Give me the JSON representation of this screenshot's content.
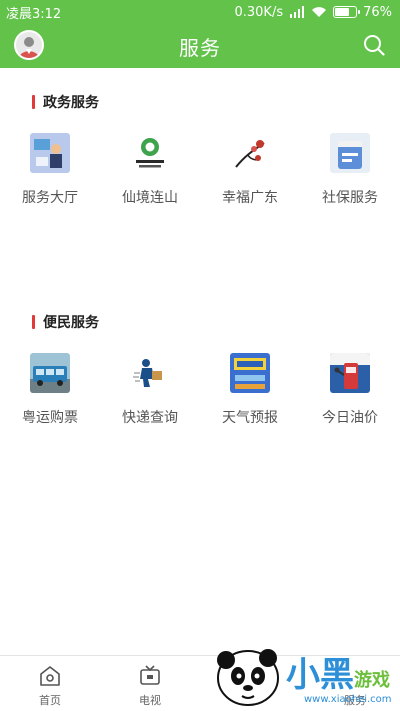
{
  "status_bar": {
    "time": "凌晨3:12",
    "speed": "0.30K/s",
    "battery": "76%",
    "battery_level": 0.76
  },
  "header": {
    "title": "服务",
    "avatar_icon": "user-avatar-icon",
    "search_icon": "search-icon"
  },
  "sections": [
    {
      "title": "政务服务",
      "items": [
        {
          "label": "服务大厅",
          "icon": "service-hall-icon"
        },
        {
          "label": "仙境连山",
          "icon": "lianshan-logo-icon"
        },
        {
          "label": "幸福广东",
          "icon": "happy-guangdong-icon"
        },
        {
          "label": "社保服务",
          "icon": "social-security-icon"
        }
      ]
    },
    {
      "title": "便民服务",
      "items": [
        {
          "label": "粤运购票",
          "icon": "bus-ticket-icon"
        },
        {
          "label": "快递查询",
          "icon": "courier-icon"
        },
        {
          "label": "天气预报",
          "icon": "weather-icon"
        },
        {
          "label": "今日油价",
          "icon": "fuel-price-icon"
        }
      ]
    }
  ],
  "tab_bar": [
    {
      "label": "首页",
      "icon": "home-icon"
    },
    {
      "label": "电视",
      "icon": "tv-icon"
    },
    {
      "label": "服务",
      "icon": "service-icon"
    }
  ],
  "watermark": {
    "text_main": "小黑游戏",
    "text_url": "www.xiaohei.com"
  },
  "colors": {
    "brand_green": "#62c24a",
    "section_marker_red": "#e03a3a"
  }
}
